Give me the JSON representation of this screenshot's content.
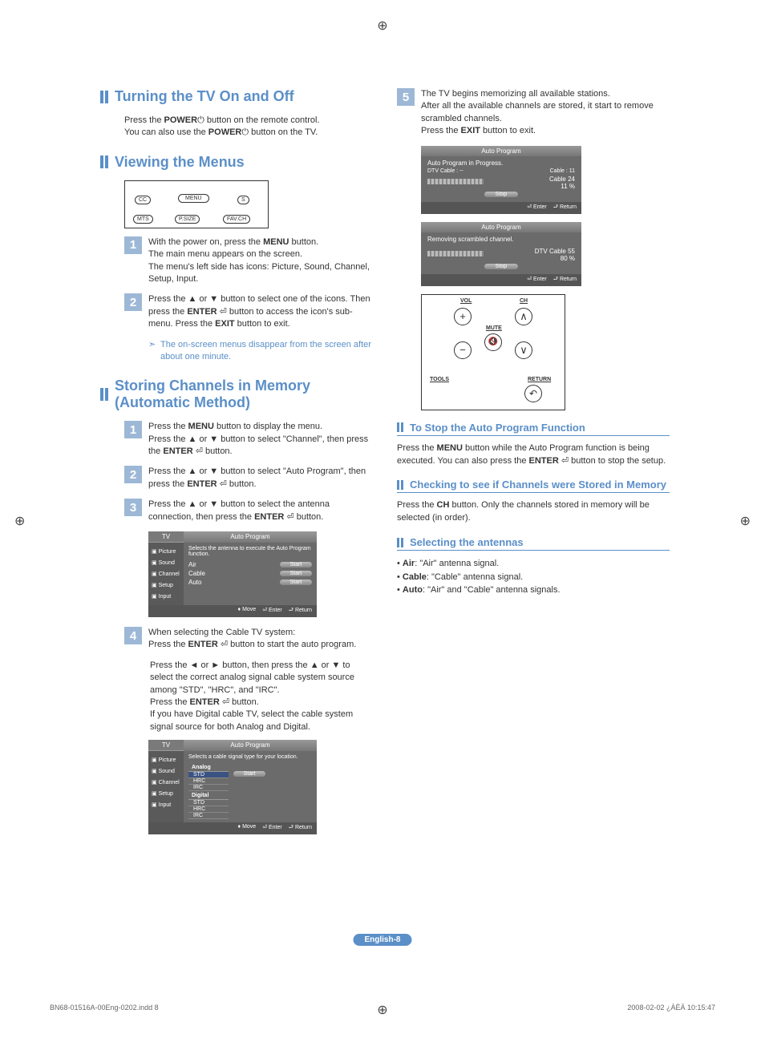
{
  "section1": {
    "title": "Turning the TV On and Off",
    "intro_a": "Press the ",
    "intro_b": " button on the remote control.",
    "intro_c": "You can also use the ",
    "intro_d": " button on the TV.",
    "power": "POWER"
  },
  "section2": {
    "title": "Viewing the Menus",
    "remote_buttons": {
      "cc": "CC",
      "menu": "MENU",
      "mts": "MTS",
      "psize": "P.SIZE",
      "favch": "FAV.CH"
    },
    "steps": [
      {
        "n": "1",
        "t1": "With the power on, press the ",
        "b1": "MENU",
        "t2": " button.",
        "t3": "The main menu appears on the screen.",
        "t4": "The menu's left side has icons: Picture, Sound, Channel, Setup, Input."
      },
      {
        "n": "2",
        "t1": "Press the ▲ or ▼ button to select one of the icons. Then press the ",
        "b1": "ENTER",
        "t2": " ⏎ button to access the icon's sub-menu. Press the ",
        "b2": "EXIT",
        "t3": " button to exit."
      }
    ],
    "note": "The on-screen menus disappear from the screen after about one minute."
  },
  "section3": {
    "title": "Storing Channels in Memory (Automatic Method)",
    "steps": {
      "s1": {
        "n": "1",
        "a": "Press the ",
        "b": "MENU",
        "c": " button to display the menu.",
        "d": "Press the ▲ or ▼ button to select \"Channel\", then press the ",
        "e": "ENTER",
        "f": " ⏎ button."
      },
      "s2": {
        "n": "2",
        "a": "Press the ▲ or ▼ button to select \"Auto Program\", then press the ",
        "b": "ENTER",
        "c": " ⏎ button."
      },
      "s3": {
        "n": "3",
        "a": "Press the ▲ or ▼ button to select the antenna connection, then press the ",
        "b": "ENTER",
        "c": " ⏎ button."
      },
      "s4": {
        "n": "4",
        "a": "When selecting the Cable TV system:",
        "b": "Press the ",
        "c": "ENTER",
        "d": " ⏎ button to start the auto program."
      },
      "s4b": {
        "a": "Press the ◄ or ► button, then press the ▲ or ▼ to select the correct analog signal cable system source among \"STD\", \"HRC\", and \"IRC\".",
        "b": "Press the ",
        "c": "ENTER",
        "d": " ⏎ button.",
        "e": "If you have Digital cable TV, select the cable system signal source for both Analog and Digital."
      }
    },
    "osd1": {
      "tv": "TV",
      "title": "Auto Program",
      "side": [
        "Picture",
        "Sound",
        "Channel",
        "Setup",
        "Input"
      ],
      "desc": "Selects the antenna to execute the Auto Program function.",
      "rows": [
        {
          "label": "Air",
          "btn": "Start"
        },
        {
          "label": "Cable",
          "btn": "Start"
        },
        {
          "label": "Auto",
          "btn": "Start"
        }
      ],
      "foot": [
        "♦ Move",
        "⏎ Enter",
        "⮐ Return"
      ]
    },
    "osd2": {
      "tv": "TV",
      "title": "Auto Program",
      "side": [
        "Picture",
        "Sound",
        "Channel",
        "Setup",
        "Input"
      ],
      "desc": "Selects a cable signal type for your location.",
      "analog": "Analog",
      "digital": "Digital",
      "opts": [
        "STD",
        "HRC",
        "IRC"
      ],
      "start": "Start",
      "foot": [
        "♦ Move",
        "⏎ Enter",
        "⮐ Return"
      ]
    }
  },
  "right": {
    "step5": {
      "n": "5",
      "a": "The TV begins memorizing all available stations.",
      "b": "After all the available channels are stored, it start to remove scrambled channels.",
      "c": "Press the ",
      "d": "EXIT",
      "e": " button to exit."
    },
    "prog1": {
      "title": "Auto Program",
      "line1": "Auto Program in Progress.",
      "dtv": "DTV Cable : --",
      "cable": "Cable : 11",
      "r1": "Cable  24",
      "r2": "11   %",
      "stop": "Stop",
      "foot": [
        "⏎ Enter",
        "⮐ Return"
      ]
    },
    "prog2": {
      "title": "Auto Program",
      "line1": "Removing scrambled channel.",
      "r1": "DTV Cable 55",
      "r2": "80   %",
      "stop": "Stop",
      "foot": [
        "⏎ Enter",
        "⮐ Return"
      ]
    },
    "remote": {
      "vol": "VOL",
      "ch": "CH",
      "mute": "MUTE",
      "tools": "TOOLS",
      "ret": "RETURN"
    },
    "stop": {
      "title": "To Stop the Auto Program Function",
      "a": "Press the ",
      "b": "MENU",
      "c": " button while the Auto Program function is being executed. You can also press the ",
      "d": "ENTER",
      "e": " ⏎ button to stop the setup."
    },
    "check": {
      "title": "Checking to see if Channels were Stored in Memory",
      "a": "Press the ",
      "b": "CH",
      "c": " button. Only the channels stored in memory will be selected (in order)."
    },
    "ant": {
      "title": "Selecting the antennas",
      "items": [
        {
          "b": "Air",
          "t": ": \"Air\" antenna signal."
        },
        {
          "b": "Cable",
          "t": ": \"Cable\" antenna signal."
        },
        {
          "b": "Auto",
          "t": ": \"Air\" and \"Cable\" antenna signals."
        }
      ]
    }
  },
  "badge": "English-8",
  "footer": {
    "left": "BN68-01516A-00Eng-0202.indd   8",
    "right": "2008-02-02   ¿ÀÈÄ 10:15:47"
  }
}
